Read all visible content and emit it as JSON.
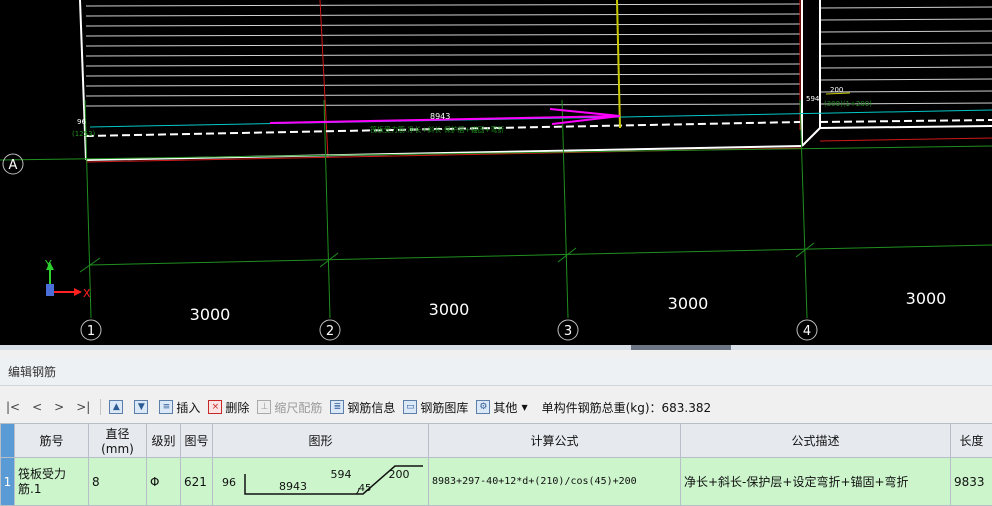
{
  "cad": {
    "axis_a": "A",
    "grid_numbers": [
      "1",
      "2",
      "3",
      "4"
    ],
    "spans": [
      "3000",
      "3000",
      "3000",
      "3000"
    ],
    "coord_y": "Y",
    "coord_x": "X",
    "dim_length": "8943",
    "dim_left_top": "96",
    "dim_left_bottom": "(1253)",
    "dim_right_594": "594",
    "dim_right_200": "200",
    "dim_right_note": "(300)(1+200)",
    "bar_label": "筏板受力筋:净长+斜长-保护层+锚固+弯折",
    "colors": {
      "background": "#000000",
      "grid": "#1f8f1f",
      "slab_edge": "#ffffff",
      "red": "#d01818",
      "rebar": "#ff00ff",
      "cyan": "#00c8c8",
      "yellow": "#c8c800"
    }
  },
  "panel": {
    "title": "编辑钢筋",
    "toolbar": {
      "first": "|<",
      "prev": "<",
      "next": ">",
      "last": ">|",
      "insert": "插入",
      "delete": "删除",
      "scale_config": "缩尺配筋",
      "rebar_info": "钢筋信息",
      "rebar_library": "钢筋图库",
      "other": "其他",
      "total_label": "单构件钢筋总重(kg)：683.382"
    },
    "columns": [
      "筋号",
      "直径(mm)",
      "级别",
      "图号",
      "图形",
      "计算公式",
      "公式描述",
      "长度"
    ],
    "rows": [
      {
        "index": "1",
        "name": "筏板受力筋.1",
        "diameter": "8",
        "grade": "Φ",
        "figure_no": "621",
        "shape": {
          "left": "96",
          "middle": "8943",
          "slope": "594",
          "angle": "45",
          "right": "200"
        },
        "formula": "8983+297-40+12*d+(210)/cos(45)+200",
        "description": "净长+斜长-保护层+设定弯折+锚固+弯折",
        "length": "9833"
      }
    ]
  }
}
